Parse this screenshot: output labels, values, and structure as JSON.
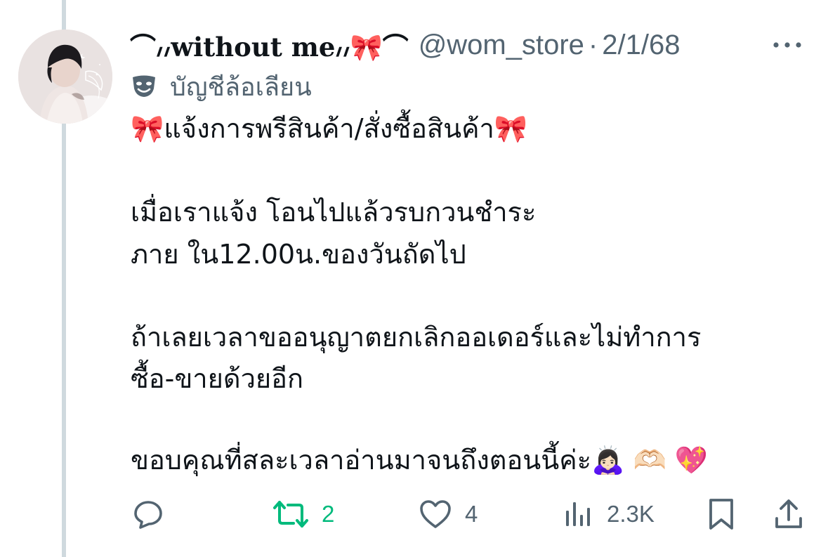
{
  "tweet": {
    "display_name": "⌒៸៸without me៸៸🎀⌒",
    "handle": "@wom_store",
    "separator": "·",
    "date": "2/1/68",
    "more_icon": "more-dots-icon",
    "parody_label": "บัญชีล้อเลียน",
    "parody_icon": "theater-mask-icon",
    "lines": {
      "l1": "🎀แจ้งการพรีสินค้า/สั่งซื้อสินค้า🎀",
      "l2": "เมื่อเราแจ้ง โอนไปแล้วรบกวนชำระ",
      "l3": "ภาย ใน12.00น.ของวันถัดไป",
      "l4": "ถ้าเลยเวลาขออนุญาตยกเลิกออเดอร์และไม่ทำการ",
      "l5": "ซื้อ-ขายด้วยอีก",
      "l6": "ขอบคุณที่สละเวลาอ่านมาจนถึงตอนนี้ค่ะ🙇🏻‍♀️ 🫶🏻 💖"
    },
    "actions": {
      "reply_icon": "reply-bubble-icon",
      "reply_count": "",
      "retweet_icon": "retweet-icon",
      "retweet_count": "2",
      "like_icon": "heart-icon",
      "like_count": "4",
      "views_icon": "views-bar-chart-icon",
      "views_count": "2.3K",
      "bookmark_icon": "bookmark-icon",
      "share_icon": "share-upload-icon"
    },
    "colors": {
      "text": "#0f1419",
      "secondary": "#536471",
      "retweet_active": "#00ba7c",
      "thread_line": "#cfd9de"
    }
  }
}
